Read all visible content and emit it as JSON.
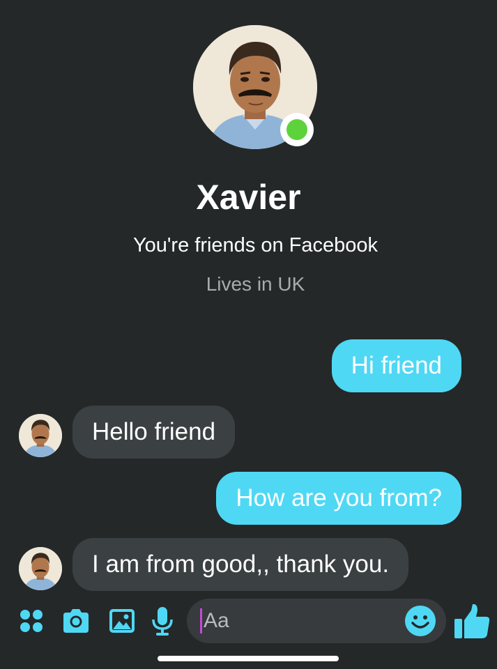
{
  "profile": {
    "name": "Xavier",
    "subtitle": "You're friends on Facebook",
    "location": "Lives in UK",
    "online": true
  },
  "messages": [
    {
      "direction": "sent",
      "text": "Hi friend"
    },
    {
      "direction": "received",
      "text": "Hello friend"
    },
    {
      "direction": "sent",
      "text": "How are you from?"
    },
    {
      "direction": "received",
      "text": "I am from good,, thank you."
    }
  ],
  "composer": {
    "placeholder": "Aa",
    "icons": [
      "apps-icon",
      "camera-icon",
      "gallery-icon",
      "microphone-icon",
      "emoji-icon",
      "like-icon"
    ]
  },
  "colors": {
    "background": "#242829",
    "accent": "#4fd8f4",
    "received_bubble": "#3b4043",
    "online": "#5ed23b"
  }
}
